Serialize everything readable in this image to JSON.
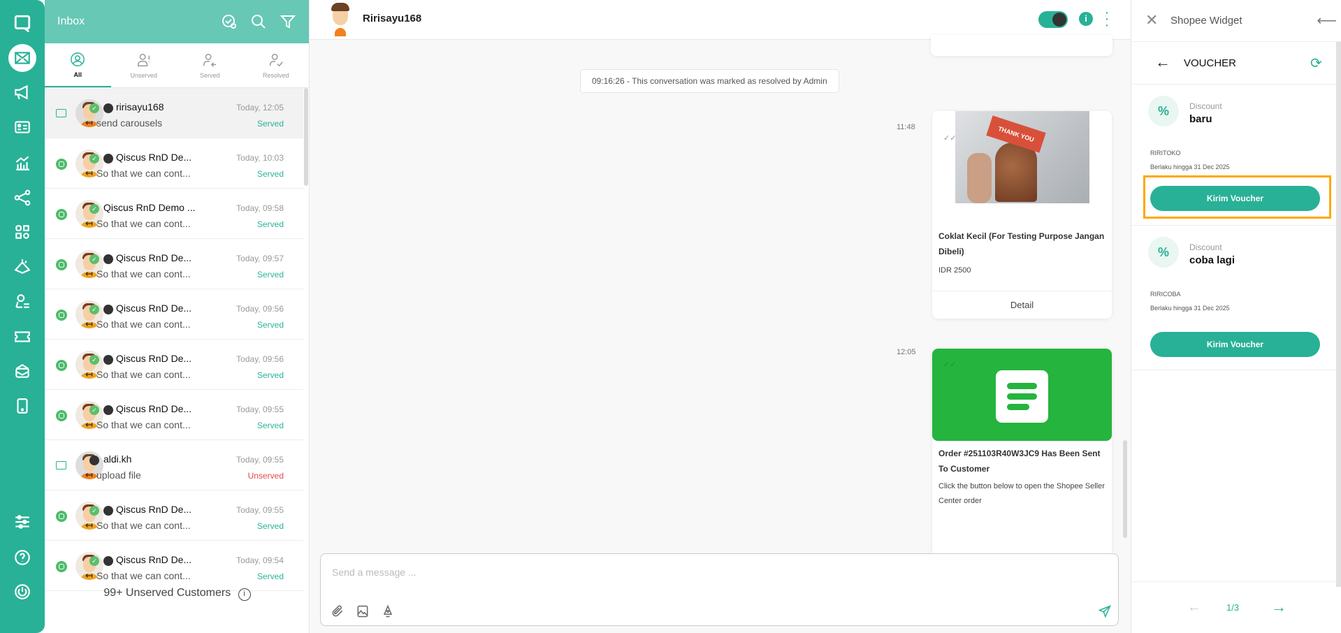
{
  "nav": {
    "items": [
      "logo",
      "inbox",
      "broadcast",
      "contacts",
      "analytics",
      "integrations",
      "apps",
      "ai-agent",
      "customer",
      "ticket",
      "database",
      "mobile",
      "settings",
      "help",
      "logout"
    ]
  },
  "inbox": {
    "title": "Inbox",
    "tabs": [
      {
        "label": "All"
      },
      {
        "label": "Unserved"
      },
      {
        "label": "Served"
      },
      {
        "label": "Resolved"
      }
    ],
    "conversations": [
      {
        "name": "ririsayu168",
        "preview": "send carousels",
        "time": "Today, 12:05",
        "status": "Served"
      },
      {
        "name": "Qiscus RnD De...",
        "preview": "So that we can cont...",
        "time": "Today, 10:03",
        "status": "Served"
      },
      {
        "name": "Qiscus RnD Demo ...",
        "preview": "So that we can cont...",
        "time": "Today, 09:58",
        "status": "Served"
      },
      {
        "name": "Qiscus RnD De...",
        "preview": "So that we can cont...",
        "time": "Today, 09:57",
        "status": "Served"
      },
      {
        "name": "Qiscus RnD De...",
        "preview": "So that we can cont...",
        "time": "Today, 09:56",
        "status": "Served"
      },
      {
        "name": "Qiscus RnD De...",
        "preview": "So that we can cont...",
        "time": "Today, 09:56",
        "status": "Served"
      },
      {
        "name": "Qiscus RnD De...",
        "preview": "So that we can cont...",
        "time": "Today, 09:55",
        "status": "Served"
      },
      {
        "name": "aldi.kh",
        "preview": "upload file",
        "time": "Today, 09:55",
        "status": "Unserved"
      },
      {
        "name": "Qiscus RnD De...",
        "preview": "So that we can cont...",
        "time": "Today, 09:55",
        "status": "Served"
      },
      {
        "name": "Qiscus RnD De...",
        "preview": "So that we can cont...",
        "time": "Today, 09:54",
        "status": "Served"
      }
    ],
    "footer": "99+ Unserved Customers"
  },
  "chat": {
    "contact": "Ririsayu168",
    "info_icon": "i",
    "system_message": "09:16:26 - This conversation was marked as resolved by Admin",
    "messages": [
      {
        "time": "11:48",
        "title": "Coklat Kecil (For Testing Purpose Jangan Dibeli)",
        "price": "IDR 2500",
        "button": "Detail",
        "image_text": "THANK YOU"
      },
      {
        "time": "12:05",
        "title": "Order #251103R40W3JC9 Has Been Sent To Customer",
        "desc": "Click the button below to open the Shopee Seller Center order"
      }
    ],
    "composer": {
      "placeholder": "Send a message ..."
    }
  },
  "widget": {
    "title": "Shopee Widget",
    "section": "VOUCHER",
    "vouchers": [
      {
        "type": "Discount",
        "name": "baru",
        "code": "RIRITOKO",
        "valid": "Berlaku hingga 31 Dec 2025",
        "button": "Kirim Voucher"
      },
      {
        "type": "Discount",
        "name": "coba lagi",
        "code": "RIRICOBA",
        "valid": "Berlaku hingga 31 Dec 2025",
        "button": "Kirim Voucher"
      }
    ],
    "page": "1/3"
  },
  "colors": {
    "accent": "#28b196",
    "header": "#66c8b5",
    "highlight": "#ffa800",
    "unserved": "#e04b4b",
    "order": "#25b43e"
  }
}
